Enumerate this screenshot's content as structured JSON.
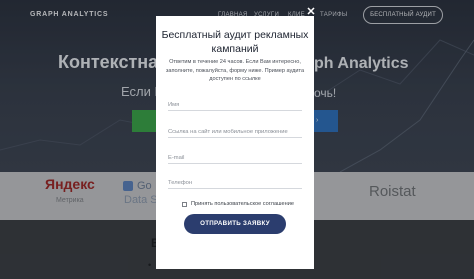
{
  "header": {
    "logo": "GRAPH ANALYTICS",
    "nav": [
      "ГЛАВНАЯ",
      "УСЛУГИ",
      "КЛИЕ",
      "ТАРИФЫ"
    ],
    "audit_button": "БЕСПЛАТНЫЙ АУДИТ"
  },
  "hero": {
    "title_left": "Контекстна",
    "title_right": "ph Analytics",
    "subtitle_left": "Если В",
    "subtitle_right": "очь!"
  },
  "logos": {
    "yandex": "Яндекс",
    "yandex_sub": "Метрика",
    "google": "Go",
    "google_sub": "Data S",
    "roistat": "Roistat"
  },
  "bottom": {
    "heading_fragment": "В",
    "line_fragment": "•"
  },
  "modal": {
    "close_symbol": "✕",
    "title": "Бесплатный аудит рекламных кампаний",
    "description": "Ответим в течение 24 часов. Если Вам интересно, заполните, пожалуйста, форму ниже. Пример аудита доступен по ссылке",
    "fields": {
      "name_placeholder": "Имя",
      "site_placeholder": "Ссылка на сайт или мобильное приложение",
      "email_placeholder": "E-mail",
      "phone_placeholder": "Телефон"
    },
    "agreement_label": "Принять пользовательское соглашение",
    "submit_label": "ОТПРАВИТЬ ЗАЯВКУ"
  },
  "colors": {
    "modal_button": "#2b3d6e",
    "hero_green": "#3aa04a",
    "hero_blue": "#2f6fb8"
  }
}
